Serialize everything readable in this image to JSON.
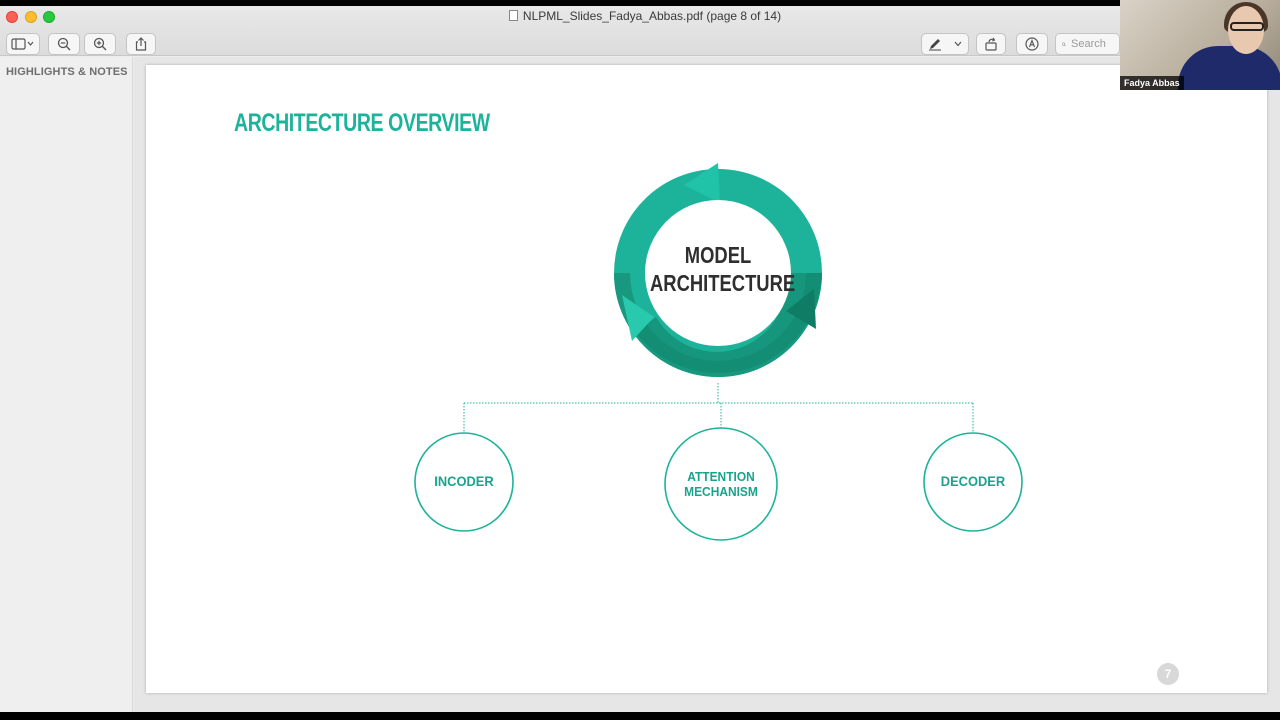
{
  "window": {
    "title": "NLPML_Slides_Fadya_Abbas.pdf (page 8 of 14)"
  },
  "toolbar": {
    "search_placeholder": "Search",
    "icons": [
      "sidebar-toggle-icon",
      "zoom-out-icon",
      "zoom-in-icon",
      "share-icon",
      "markup-pen-icon",
      "chevron-down-icon",
      "rotate-icon",
      "annotate-icon",
      "search-icon"
    ]
  },
  "sidebar": {
    "title": "HIGHLIGHTS & NOTES"
  },
  "slide": {
    "title": "ARCHITECTURE OVERVIEW",
    "center_line1": "MODEL",
    "center_line2": "ARCHITECTURE",
    "nodes": [
      {
        "line1": "INCODER",
        "line2": ""
      },
      {
        "line1": "ATTENTION",
        "line2": "MECHANISM"
      },
      {
        "line1": "DECODER",
        "line2": ""
      }
    ],
    "page_number": "7"
  },
  "webcam": {
    "name": "Fadya Abbas"
  },
  "colors": {
    "accent": "#1cb39a",
    "accent_dark": "#138b72",
    "title_text": "#2f2f2f"
  }
}
